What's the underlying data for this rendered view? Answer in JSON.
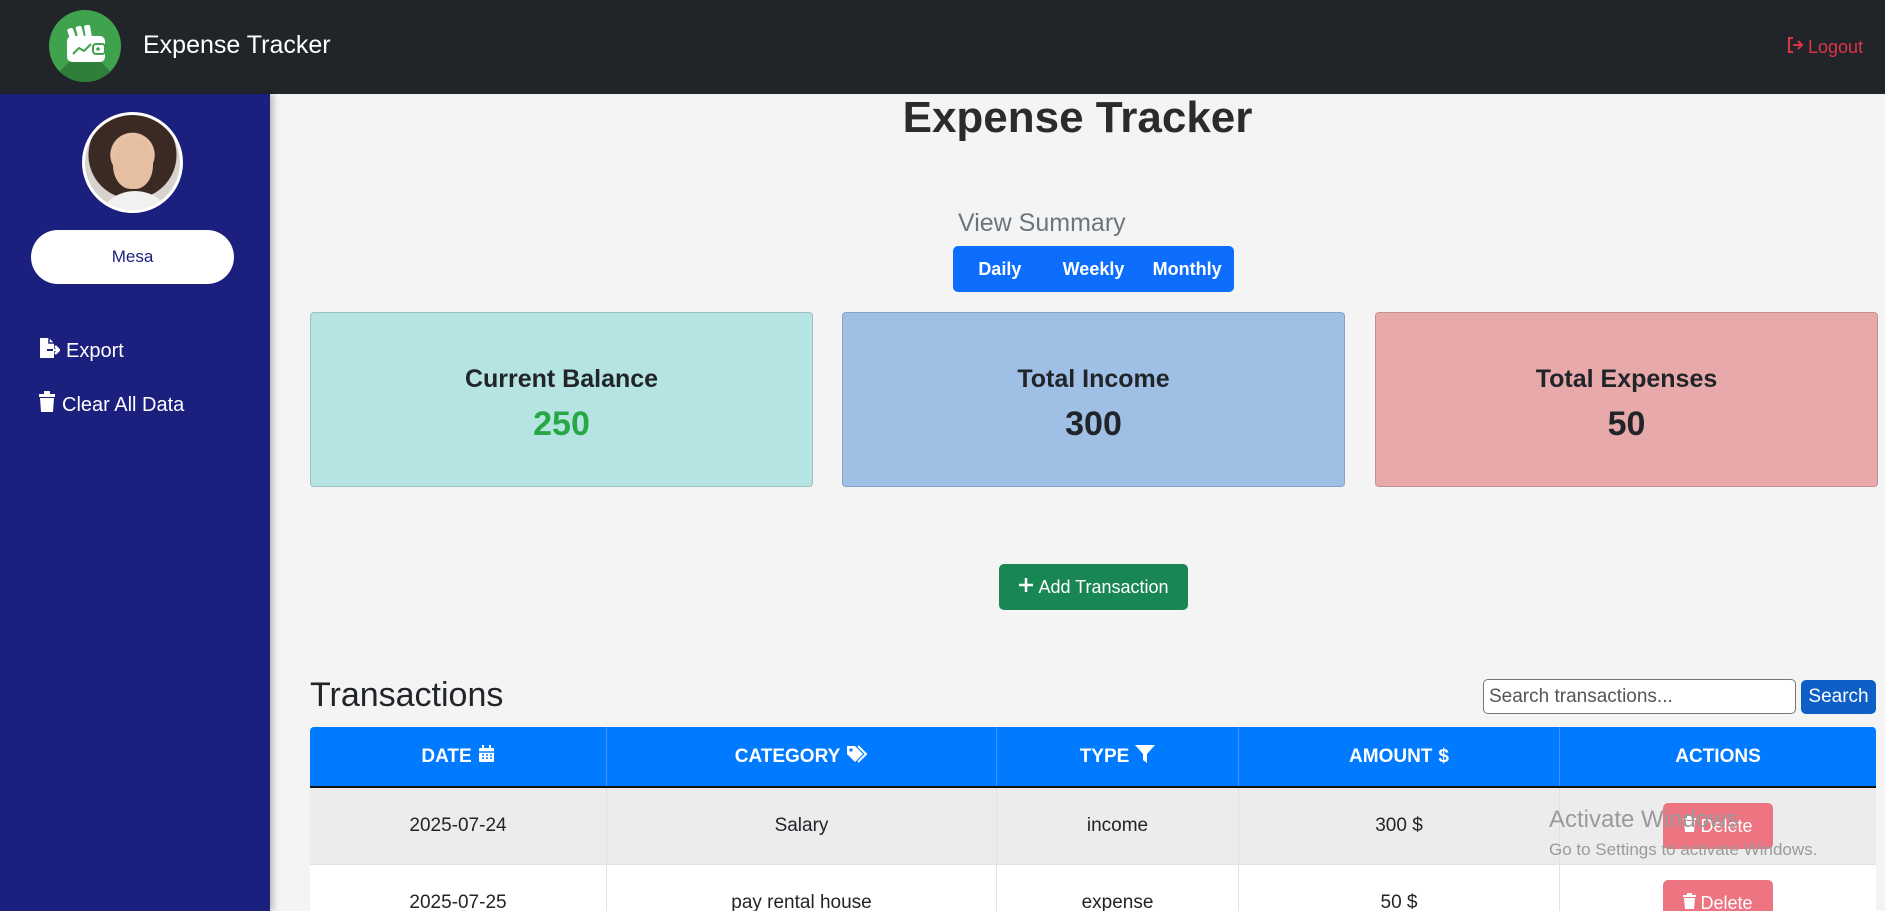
{
  "navbar": {
    "brand": "Expense Tracker",
    "logout_label": "Logout",
    "logout_color": "#dc3545"
  },
  "sidebar": {
    "username": "Mesa",
    "items": [
      {
        "label": "Export",
        "icon": "file-export-icon"
      },
      {
        "label": "Clear All Data",
        "icon": "trash-icon"
      }
    ]
  },
  "main": {
    "title": "Expense Tracker",
    "summary": {
      "label": "View Summary",
      "buttons": [
        "Daily",
        "Weekly",
        "Monthly"
      ]
    },
    "cards": [
      {
        "title": "Current Balance",
        "value": "250"
      },
      {
        "title": "Total Income",
        "value": "300"
      },
      {
        "title": "Total Expenses",
        "value": "50"
      }
    ],
    "add_button": "Add Transaction",
    "transactions": {
      "title": "Transactions",
      "search_placeholder": "Search transactions...",
      "search_button": "Search",
      "columns": [
        {
          "label": "DATE",
          "icon": "calendar-icon"
        },
        {
          "label": "CATEGORY",
          "icon": "tags-icon"
        },
        {
          "label": "TYPE",
          "icon": "filter-icon"
        },
        {
          "label": "AMOUNT",
          "icon": "dollar-icon"
        },
        {
          "label": "ACTIONS"
        }
      ],
      "rows": [
        {
          "date": "2025-07-24",
          "category": "Salary",
          "type": "income",
          "amount": "300 $",
          "action": "Delete"
        },
        {
          "date": "2025-07-25",
          "category": "pay rental house",
          "type": "expense",
          "amount": "50 $",
          "action": "Delete"
        }
      ]
    }
  },
  "watermark": {
    "line1": "Activate Windows",
    "line2": "Go to Settings to activate Windows."
  },
  "colors": {
    "navbar": "#212529",
    "sidebar": "#1b1f7e",
    "primary": "#0d6efd",
    "success": "#198754",
    "danger": "#ec7581"
  }
}
